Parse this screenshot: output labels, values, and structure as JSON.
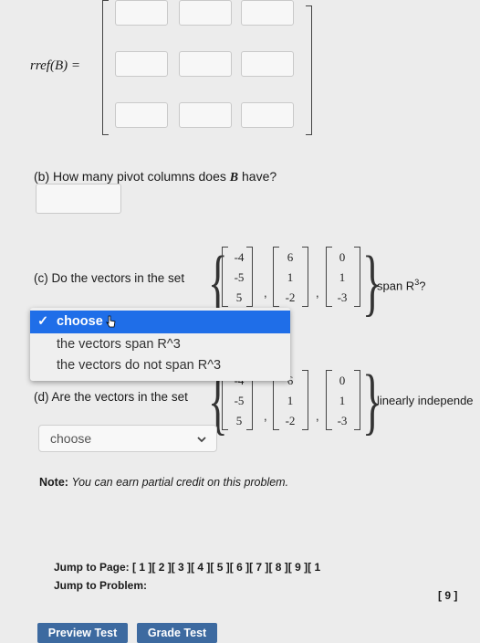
{
  "part_a": {
    "label": "rref(B) ="
  },
  "part_b": {
    "question_prefix": "(b) How many pivot columns does",
    "question_var": "B",
    "question_suffix": "have?",
    "answer_value": ""
  },
  "part_c": {
    "question_prefix": "(c) Do the vectors in the set",
    "question_suffix": "span R",
    "question_sup": "3",
    "question_end": "?",
    "vectors": [
      [
        "-4",
        "-5",
        "5"
      ],
      [
        "6",
        "1",
        "-2"
      ],
      [
        "0",
        "1",
        "-3"
      ]
    ],
    "dropdown": {
      "options": [
        "choose",
        "the vectors span R^3",
        "the vectors do not span R^3"
      ],
      "selected_index": 0
    }
  },
  "part_d": {
    "question_prefix": "(d) Are the vectors in the set",
    "question_suffix": "linearly independe",
    "vectors": [
      [
        "-4",
        "-5",
        "5"
      ],
      [
        "6",
        "1",
        "-2"
      ],
      [
        "0",
        "1",
        "-3"
      ]
    ],
    "select_value": "choose"
  },
  "note": {
    "label": "Note:",
    "text": "You can earn partial credit on this problem."
  },
  "navigation": {
    "jump_to_page_label": "Jump to Page:",
    "pages": [
      "[ 1 ]",
      "[ 2 ]",
      "[ 3 ]",
      "[ 4 ]",
      "[ 5 ]",
      "[ 6 ]",
      "[ 7 ]",
      "[ 8 ]",
      "[ 9 ]",
      "[ 1"
    ],
    "jump_to_problem_label": "Jump to Problem:",
    "problems": [
      "[ 9 ]"
    ]
  },
  "buttons": {
    "preview": "Preview Test",
    "grade": "Grade Test"
  }
}
